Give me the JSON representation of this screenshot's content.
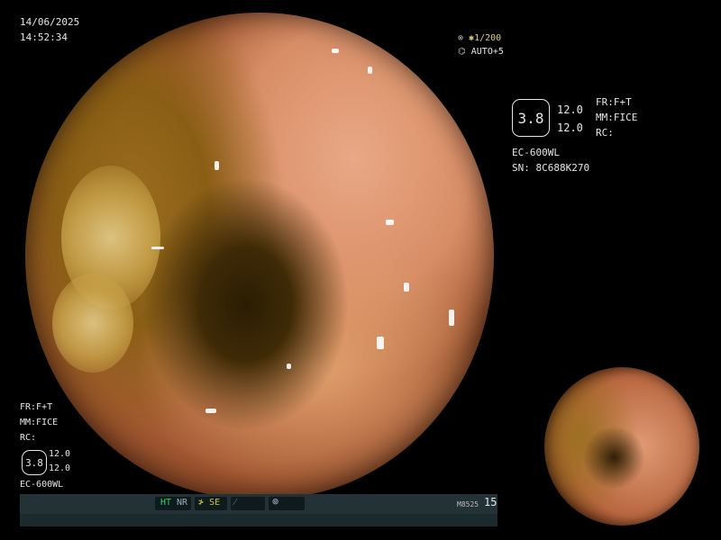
{
  "datetime": {
    "date": "14/06/2025",
    "time": "14:52:34"
  },
  "shutter": {
    "value": "1/200",
    "mode": "AUTO+5"
  },
  "info_panel": {
    "enhancement_badge": "3.8",
    "values": [
      "12.0",
      "12.0"
    ],
    "fr": "FR:F+T",
    "mm": "MM:FICE",
    "rc": "RC:",
    "scope_model": "EC-600WL",
    "serial": "SN: 8C688K270"
  },
  "lower_left_info": {
    "fr": "FR:F+T",
    "mm": "MM:FICE",
    "rc": "RC:",
    "enhancement_badge": "3.8",
    "values": [
      "12.0",
      "12.0"
    ],
    "scope_model": "EC-600WL"
  },
  "status_bar": {
    "ht": "HT",
    "nr": "NR",
    "se": "SE",
    "code": "M8525",
    "count": "15"
  }
}
